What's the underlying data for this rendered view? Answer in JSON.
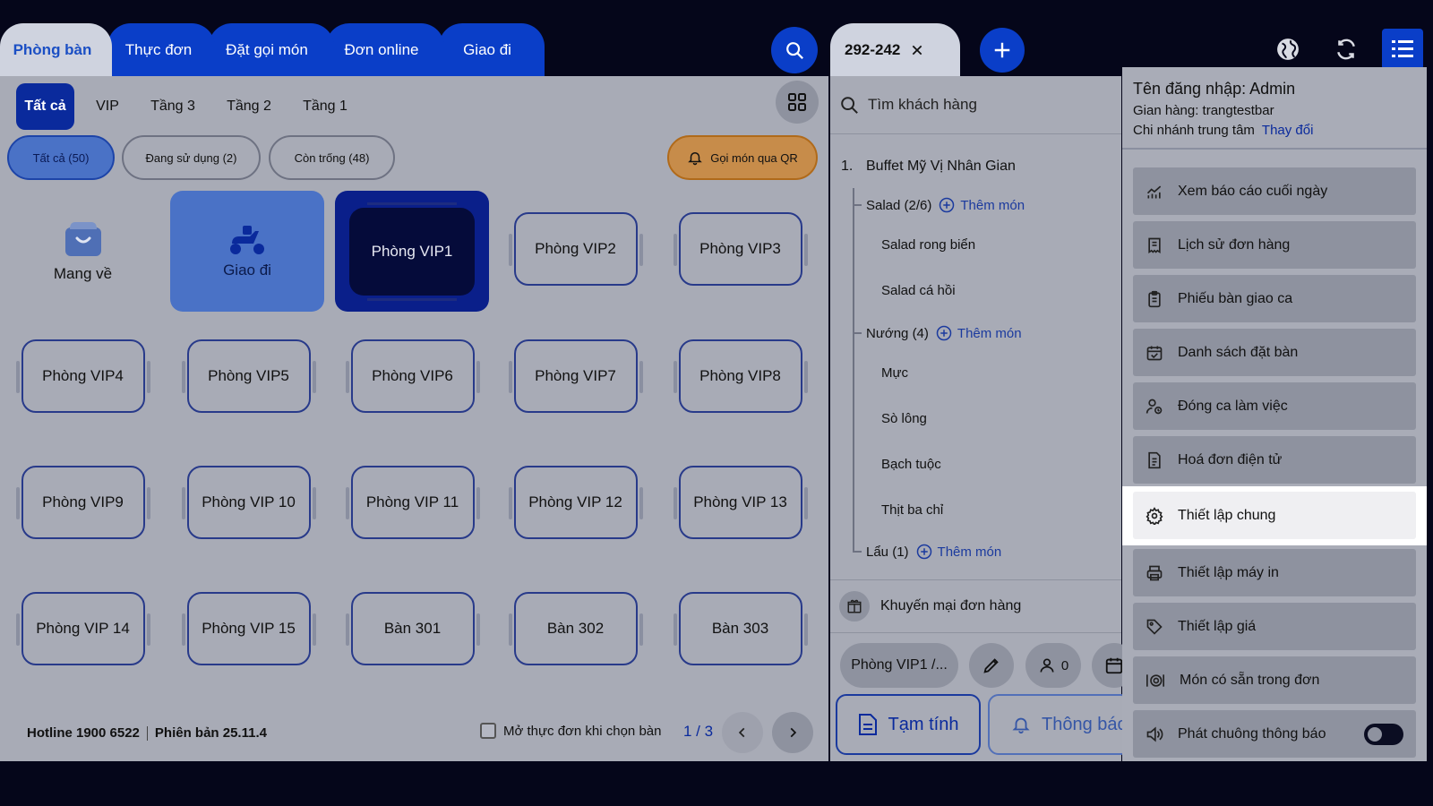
{
  "left_tabs": [
    "Phòng bàn",
    "Thực đơn",
    "Đặt gọi món",
    "Đơn online",
    "Giao đi"
  ],
  "sub_tabs": [
    "Tất cả",
    "VIP",
    "Tầng 3",
    "Tầng 2",
    "Tầng 1"
  ],
  "filters": {
    "all": "Tất cả (50)",
    "in_use": "Đang sử dụng (2)",
    "empty": "Còn trống (48)",
    "qr": "Gọi món qua QR"
  },
  "special_tiles": {
    "takeaway": "Mang về",
    "delivery": "Giao đi"
  },
  "rooms": [
    "Phòng VIP1",
    "Phòng VIP2",
    "Phòng VIP3",
    "Phòng VIP4",
    "Phòng VIP5",
    "Phòng VIP6",
    "Phòng VIP7",
    "Phòng VIP8",
    "Phòng VIP9",
    "Phòng VIP 10",
    "Phòng VIP 11",
    "Phòng VIP 12",
    "Phòng VIP 13",
    "Phòng VIP 14",
    "Phòng VIP 15",
    "Bàn 301",
    "Bàn 302",
    "Bàn 303"
  ],
  "footer": {
    "hotline": "Hotline 1900 6522",
    "version": "Phiên bản 25.11.4",
    "open_menu_label": "Mở thực đơn khi chọn bàn",
    "page": "1 / 3"
  },
  "order": {
    "tab_label": "292-242",
    "search_placeholder": "Tìm khách hàng",
    "number": "1.",
    "package": "Buffet Mỹ Vị Nhân Gian",
    "add_label": "Thêm món",
    "groups": [
      {
        "name": "Salad (2/6)",
        "items": [
          "Salad rong biển",
          "Salad cá hồi"
        ]
      },
      {
        "name": "Nướng (4)",
        "items": [
          "Mực",
          "Sò lông",
          "Bạch tuộc",
          "Thịt ba chỉ"
        ]
      },
      {
        "name": "Lẩu (1)",
        "items": []
      }
    ],
    "promo": "Khuyến mại đơn hàng",
    "room_chip": "Phòng VIP1 /...",
    "guests": "0",
    "tam_tinh": "Tạm tính",
    "thong_bao": "Thông báo"
  },
  "account": {
    "username": "Tên đăng nhập: Admin",
    "store": "Gian hàng: trangtestbar",
    "branch": "Chi nhánh trung tâm",
    "change": "Thay đổi"
  },
  "menu_items": [
    {
      "label": "Xem báo cáo cuối ngày",
      "icon": "report-chart-icon"
    },
    {
      "label": "Lịch sử đơn hàng",
      "icon": "receipt-icon"
    },
    {
      "label": "Phiếu bàn giao ca",
      "icon": "clipboard-icon"
    },
    {
      "label": "Danh sách đặt bàn",
      "icon": "calendar-check-icon"
    },
    {
      "label": "Đóng ca làm việc",
      "icon": "user-clock-icon"
    },
    {
      "label": "Hoá đơn điện tử",
      "icon": "e-invoice-icon"
    },
    {
      "label": "Thiết lập chung",
      "icon": "gear-icon"
    },
    {
      "label": "Thiết lập máy in",
      "icon": "printer-icon"
    },
    {
      "label": "Thiết lập giá",
      "icon": "price-tag-icon"
    },
    {
      "label": "Món có sẵn trong đơn",
      "icon": "dish-icon"
    },
    {
      "label": "Phát chuông thông báo",
      "icon": "speaker-icon"
    }
  ],
  "colors": {
    "primary": "#0a3ec8",
    "overlay_bg": "#a8abb6",
    "highlight": "#efeff2",
    "qr_orange": "#c78c4a"
  }
}
